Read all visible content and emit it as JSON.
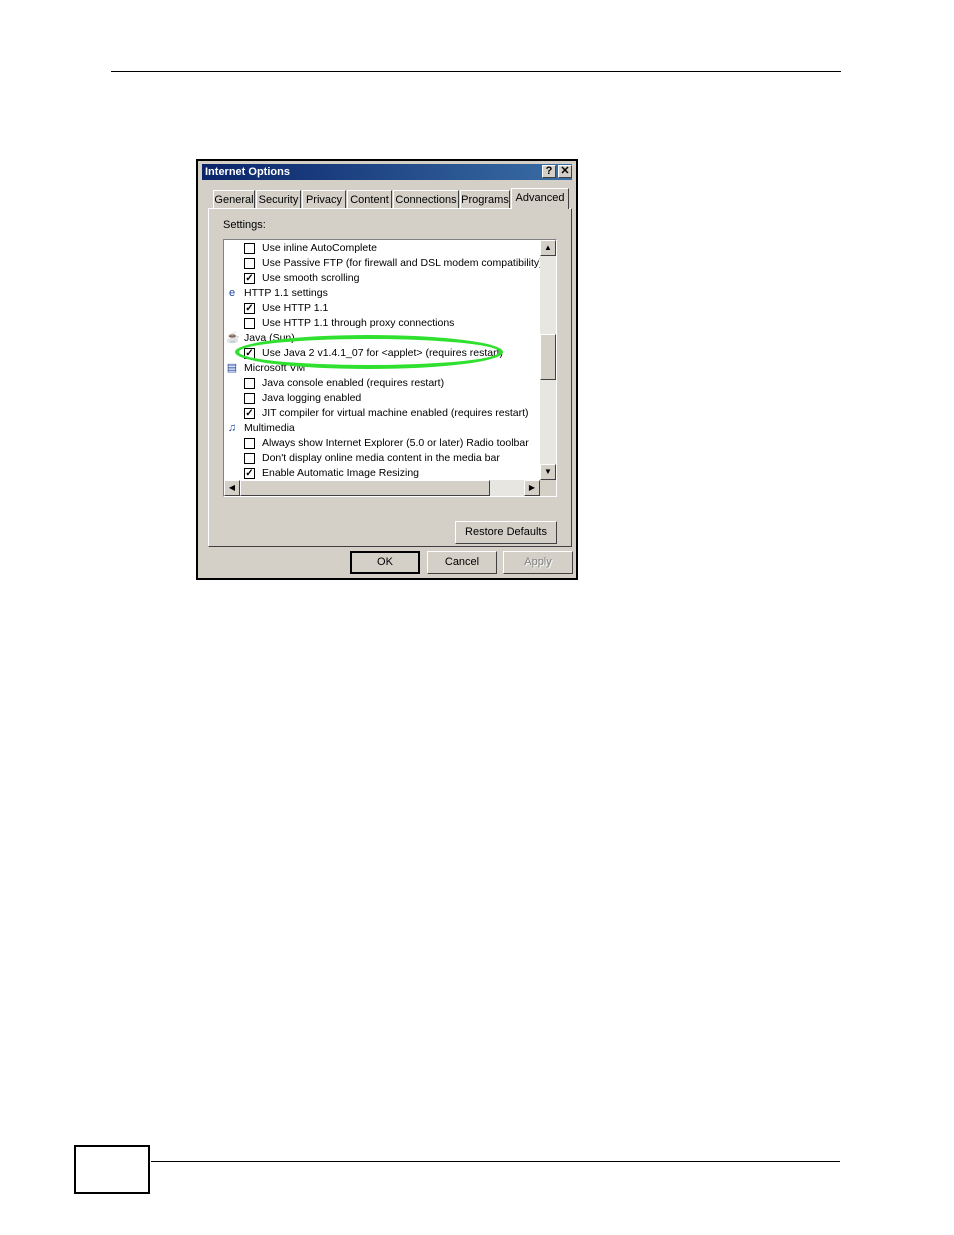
{
  "dialog": {
    "title": "Internet Options",
    "help_btn": "?",
    "close_btn": "✕"
  },
  "tabs": [
    "General",
    "Security",
    "Privacy",
    "Content",
    "Connections",
    "Programs",
    "Advanced"
  ],
  "active_tab": "Advanced",
  "settings_label": "Settings:",
  "settings_list": [
    {
      "type": "check",
      "label": "Use inline AutoComplete",
      "checked": false
    },
    {
      "type": "check",
      "label": "Use Passive FTP (for firewall and DSL modem compatibility)",
      "checked": false
    },
    {
      "type": "check",
      "label": "Use smooth scrolling",
      "checked": true
    },
    {
      "type": "group",
      "label": "HTTP 1.1 settings",
      "icon": "globe-icon"
    },
    {
      "type": "check",
      "label": "Use HTTP 1.1",
      "checked": true
    },
    {
      "type": "check",
      "label": "Use HTTP 1.1 through proxy connections",
      "checked": false
    },
    {
      "type": "group",
      "label": "Java (Sun)",
      "icon": "java-icon"
    },
    {
      "type": "check",
      "label": "Use Java 2 v1.4.1_07 for <applet> (requires restart)",
      "checked": true
    },
    {
      "type": "group",
      "label": "Microsoft VM",
      "icon": "document-icon"
    },
    {
      "type": "check",
      "label": "Java console enabled (requires restart)",
      "checked": false
    },
    {
      "type": "check",
      "label": "Java logging enabled",
      "checked": false
    },
    {
      "type": "check",
      "label": "JIT compiler for virtual machine enabled (requires restart)",
      "checked": true
    },
    {
      "type": "group",
      "label": "Multimedia",
      "icon": "multimedia-icon"
    },
    {
      "type": "check",
      "label": "Always show Internet Explorer (5.0 or later) Radio toolbar",
      "checked": false
    },
    {
      "type": "check",
      "label": "Don't display online media content in the media bar",
      "checked": false
    },
    {
      "type": "check",
      "label": "Enable Automatic Image Resizing",
      "checked": true
    }
  ],
  "buttons": {
    "restore_defaults": "Restore Defaults",
    "ok": "OK",
    "cancel": "Cancel",
    "apply": "Apply"
  },
  "check_glyph": "✓",
  "highlight_color": "#2fe02f"
}
